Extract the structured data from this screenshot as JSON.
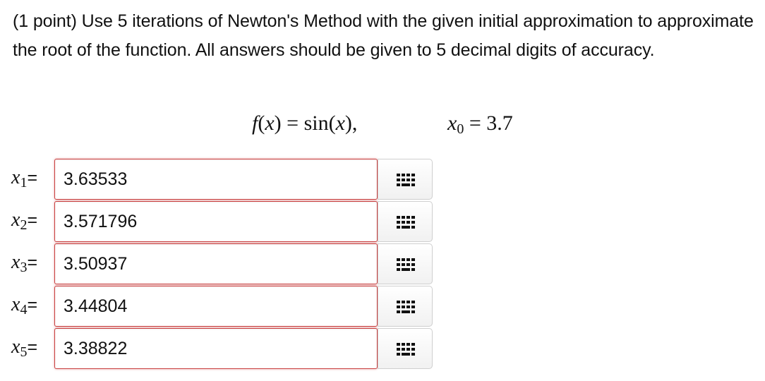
{
  "problem": {
    "text": "(1 point) Use 5 iterations of Newton's Method with the given initial approximation to approximate the root of the function. All answers should be given to 5 decimal digits of accuracy."
  },
  "formula": {
    "function_lhs": "f(x) = sin(x),",
    "initial_name": "x",
    "initial_sub": "0",
    "initial_value": "= 3.7"
  },
  "answers": [
    {
      "name": "x",
      "sub": "1",
      "eq": "=",
      "value": "3.63533"
    },
    {
      "name": "x",
      "sub": "2",
      "eq": "=",
      "value": "3.571796"
    },
    {
      "name": "x",
      "sub": "3",
      "eq": "=",
      "value": "3.50937"
    },
    {
      "name": "x",
      "sub": "4",
      "eq": "=",
      "value": "3.44804"
    },
    {
      "name": "x",
      "sub": "5",
      "eq": "=",
      "value": "3.38822"
    }
  ],
  "icons": {
    "editor_button_icon": "equation-editor-grid-icon"
  },
  "colors": {
    "error_border": "#c93f3f",
    "button_border": "#cfcfcf"
  }
}
